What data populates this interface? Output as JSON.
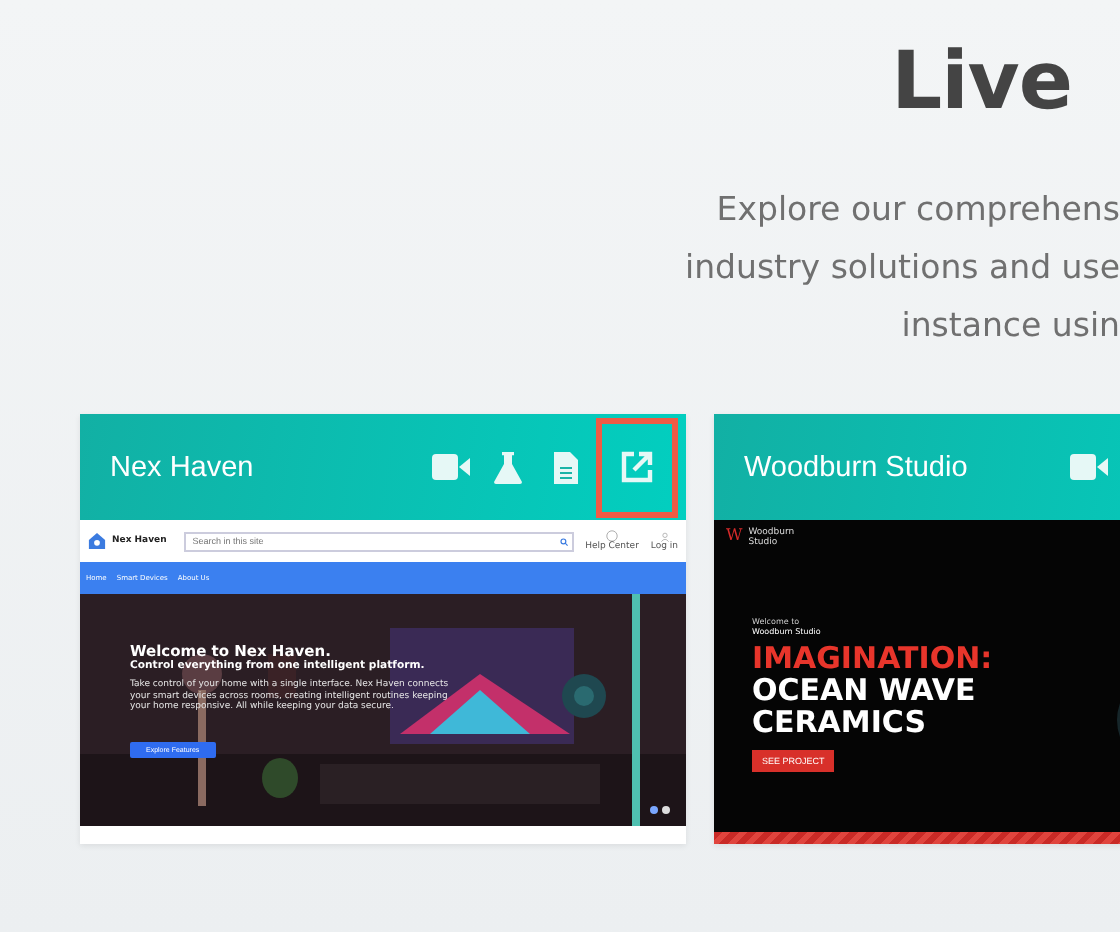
{
  "header": {
    "title": "Live",
    "subtitle_lines": [
      "Explore our comprehens",
      "industry solutions and use",
      "instance usin"
    ]
  },
  "cards": [
    {
      "title": "Nex Haven",
      "icons": [
        {
          "kind": "video",
          "highlighted": false
        },
        {
          "kind": "flask",
          "highlighted": false
        },
        {
          "kind": "document",
          "highlighted": false
        },
        {
          "kind": "external-link",
          "highlighted": true
        }
      ],
      "preview": {
        "kind": "smart-home",
        "brand": "Nex Haven",
        "search": {
          "placeholder": "Search in this site"
        },
        "actions": [
          "Help Center",
          "Log in"
        ],
        "nav": [
          "Home",
          "Smart Devices",
          "About Us"
        ],
        "heading": "Welcome to Nex Haven.",
        "subheading": "Control everything from one intelligent platform.",
        "body": "Take control of your home with a single interface. Nex Haven connects your smart devices across rooms, creating intelligent routines keeping your home responsive. All while keeping your data secure.",
        "button": "Explore Features",
        "dots": [
          {
            "selected": true
          },
          {
            "selected": false
          }
        ]
      }
    },
    {
      "title": "Woodburn Studio",
      "icons": [
        {
          "kind": "video",
          "highlighted": false
        }
      ],
      "preview": {
        "kind": "studio",
        "logo_mark": "W",
        "logo_lines": [
          "Woodburn",
          "Studio"
        ],
        "intro": "Welcome to",
        "brand": "Woodburn Studio",
        "accent_line": "IMAGINATION:",
        "lines": [
          "OCEAN WAVE",
          "CERAMICS"
        ],
        "button": "SEE PROJECT"
      }
    }
  ]
}
